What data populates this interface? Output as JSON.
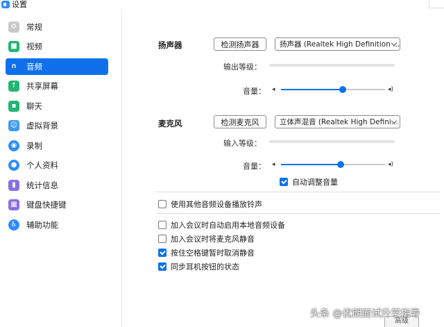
{
  "window": {
    "title": "设置"
  },
  "sidebar": {
    "items": [
      {
        "label": "常规",
        "icon": "gear-icon",
        "color": "#c9c9c9",
        "glyph": "⚙",
        "active": false
      },
      {
        "label": "视频",
        "icon": "video-icon",
        "color": "#22b573",
        "glyph": "■",
        "active": false
      },
      {
        "label": "音频",
        "icon": "headphones-icon",
        "color": "#0e71eb",
        "glyph": "∩",
        "active": true
      },
      {
        "label": "共享屏幕",
        "icon": "share-screen-icon",
        "color": "#22b573",
        "glyph": "↑",
        "active": false
      },
      {
        "label": "聊天",
        "icon": "chat-icon",
        "color": "#22b573",
        "glyph": "▪",
        "active": false
      },
      {
        "label": "虚拟背景",
        "icon": "virtual-background-icon",
        "color": "#3b9bf0",
        "glyph": "☺",
        "active": false
      },
      {
        "label": "录制",
        "icon": "record-icon",
        "color": "#2d8cff",
        "glyph": "◉",
        "active": false
      },
      {
        "label": "个人资料",
        "icon": "profile-icon",
        "color": "#2d8cff",
        "glyph": "●",
        "active": false
      },
      {
        "label": "统计信息",
        "icon": "statistics-icon",
        "color": "#8a6ee8",
        "glyph": "▮",
        "active": false
      },
      {
        "label": "键盘快捷键",
        "icon": "keyboard-icon",
        "color": "#8a6ee8",
        "glyph": "▦",
        "active": false
      },
      {
        "label": "辅助功能",
        "icon": "accessibility-icon",
        "color": "#2d8cff",
        "glyph": "♿",
        "active": false
      }
    ]
  },
  "speaker": {
    "section_label": "扬声器",
    "test_button": "检测扬声器",
    "device": "扬声器 (Realtek High Definition ...",
    "output_level_label": "输出等级：",
    "volume_label": "音量：",
    "volume": 0.59
  },
  "microphone": {
    "section_label": "麦克风",
    "test_button": "检测麦克风",
    "device": "立体声混音 (Realtek High Defini...",
    "input_level_label": "输入等级：",
    "volume_label": "音量：",
    "volume": 0.57,
    "auto_adjust_label": "自动调整音量",
    "auto_adjust_checked": true
  },
  "options": {
    "ring_separate_label": "使用其他音频设备播放铃声",
    "ring_separate_checked": false,
    "auto_join_audio_label": "加入会议时自动启用本地音频设备",
    "auto_join_audio_checked": false,
    "mute_on_join_label": "加入会议时将麦克风静音",
    "mute_on_join_checked": false,
    "space_unmute_label": "按住空格键暂时取消静音",
    "space_unmute_checked": true,
    "sync_headset_label": "同步耳机按钮的状态",
    "sync_headset_checked": true
  },
  "footer": {
    "button_label": "高级"
  },
  "watermark": "头条 @优朗面试升学指导"
}
